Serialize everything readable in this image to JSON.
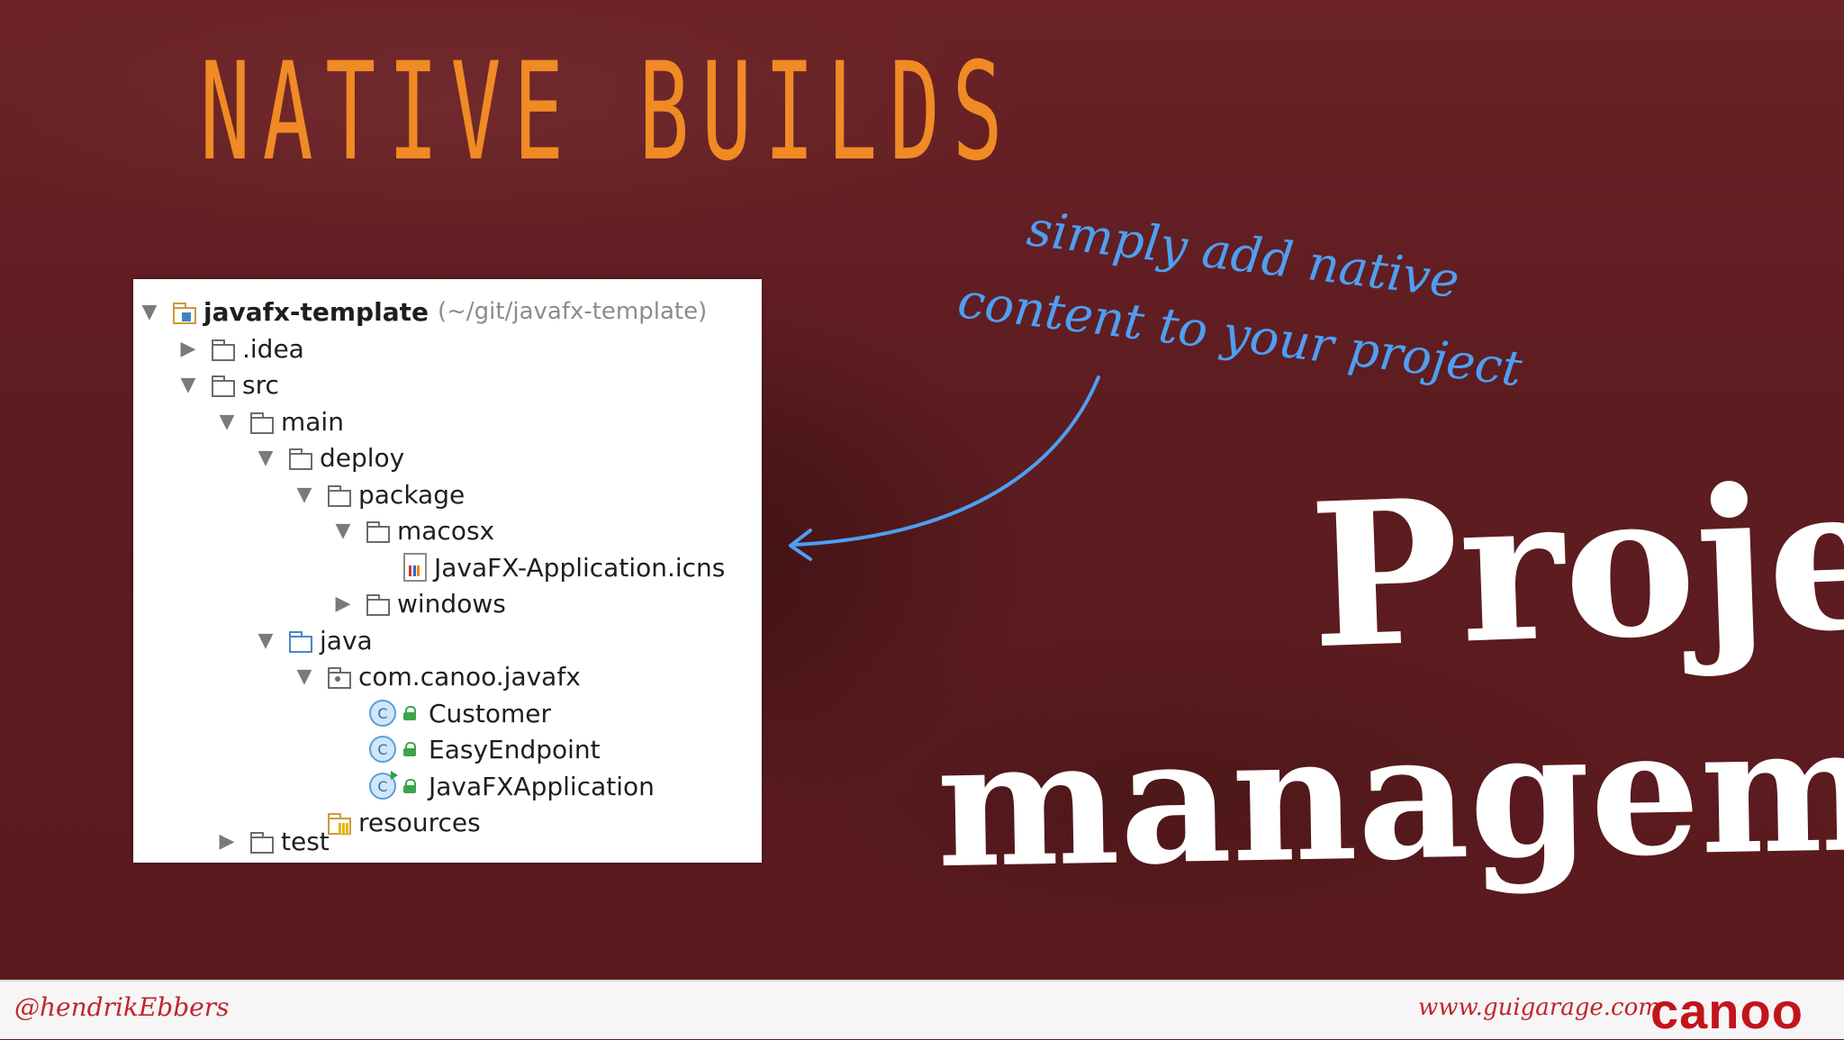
{
  "slide": {
    "title": "NATIVE BUILDS",
    "annotation_line1": "simply add native",
    "annotation_line2": "content to your project",
    "headline_line1": "Project",
    "headline_line2": "management"
  },
  "tree": {
    "rows": [
      {
        "label": "javafx-template",
        "extra": "(~/git/javafx-template)",
        "toggle": "▼"
      },
      {
        "label": ".idea",
        "toggle": "▶"
      },
      {
        "label": "src",
        "toggle": "▼"
      },
      {
        "label": "main",
        "toggle": "▼"
      },
      {
        "label": "deploy",
        "toggle": "▼"
      },
      {
        "label": "package",
        "toggle": "▼"
      },
      {
        "label": "macosx",
        "toggle": "▼"
      },
      {
        "label": "JavaFX-Application.icns",
        "toggle": ""
      },
      {
        "label": "windows",
        "toggle": "▶"
      },
      {
        "label": "java",
        "toggle": "▼"
      },
      {
        "label": "com.canoo.javafx",
        "toggle": "▼"
      },
      {
        "label": "Customer",
        "toggle": "",
        "class_letter": "C"
      },
      {
        "label": "EasyEndpoint",
        "toggle": "",
        "class_letter": "C"
      },
      {
        "label": "JavaFXApplication",
        "toggle": "",
        "class_letter": "C"
      },
      {
        "label": "resources",
        "toggle": ""
      },
      {
        "label": "test",
        "toggle": "▶"
      }
    ]
  },
  "footer": {
    "handle": "@hendrikEbbers",
    "site": "www.guigarage.com",
    "logo": "canoo"
  },
  "colors": {
    "title": "#f08a24",
    "annotation": "#4e9ff2",
    "background": "#5e1c1f",
    "brand": "#c3141b"
  }
}
